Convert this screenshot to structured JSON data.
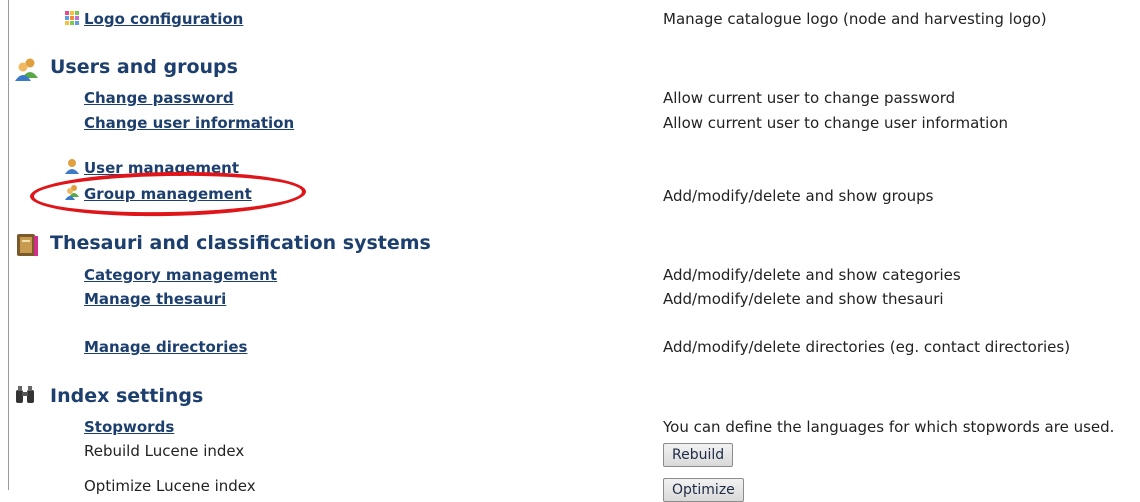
{
  "logo_configuration": {
    "label": "Logo configuration",
    "description": "Manage catalogue logo (node and harvesting logo)"
  },
  "sections": {
    "users": {
      "title": "Users and groups",
      "change_password": {
        "label": "Change password",
        "description": "Allow current user to change password"
      },
      "change_user_info": {
        "label": "Change user information",
        "description": "Allow current user to change user information"
      },
      "user_management": {
        "label": "User management"
      },
      "group_management": {
        "label": "Group management",
        "description": "Add/modify/delete and show groups"
      }
    },
    "thesauri": {
      "title": "Thesauri and classification systems",
      "category_management": {
        "label": "Category management",
        "description": "Add/modify/delete and show categories"
      },
      "manage_thesauri": {
        "label": "Manage thesauri",
        "description": "Add/modify/delete and show thesauri"
      },
      "manage_directories": {
        "label": "Manage directories",
        "description": "Add/modify/delete directories (eg. contact directories)"
      }
    },
    "index": {
      "title": "Index settings",
      "stopwords": {
        "label": "Stopwords",
        "description": "You can define the languages for which stopwords are used."
      },
      "rebuild": {
        "label": "Rebuild Lucene index",
        "button": "Rebuild"
      },
      "optimize": {
        "label": "Optimize Lucene index",
        "button": "Optimize"
      }
    }
  },
  "annotation": {
    "color": "#e0151a",
    "highlight": "group-management-link"
  }
}
